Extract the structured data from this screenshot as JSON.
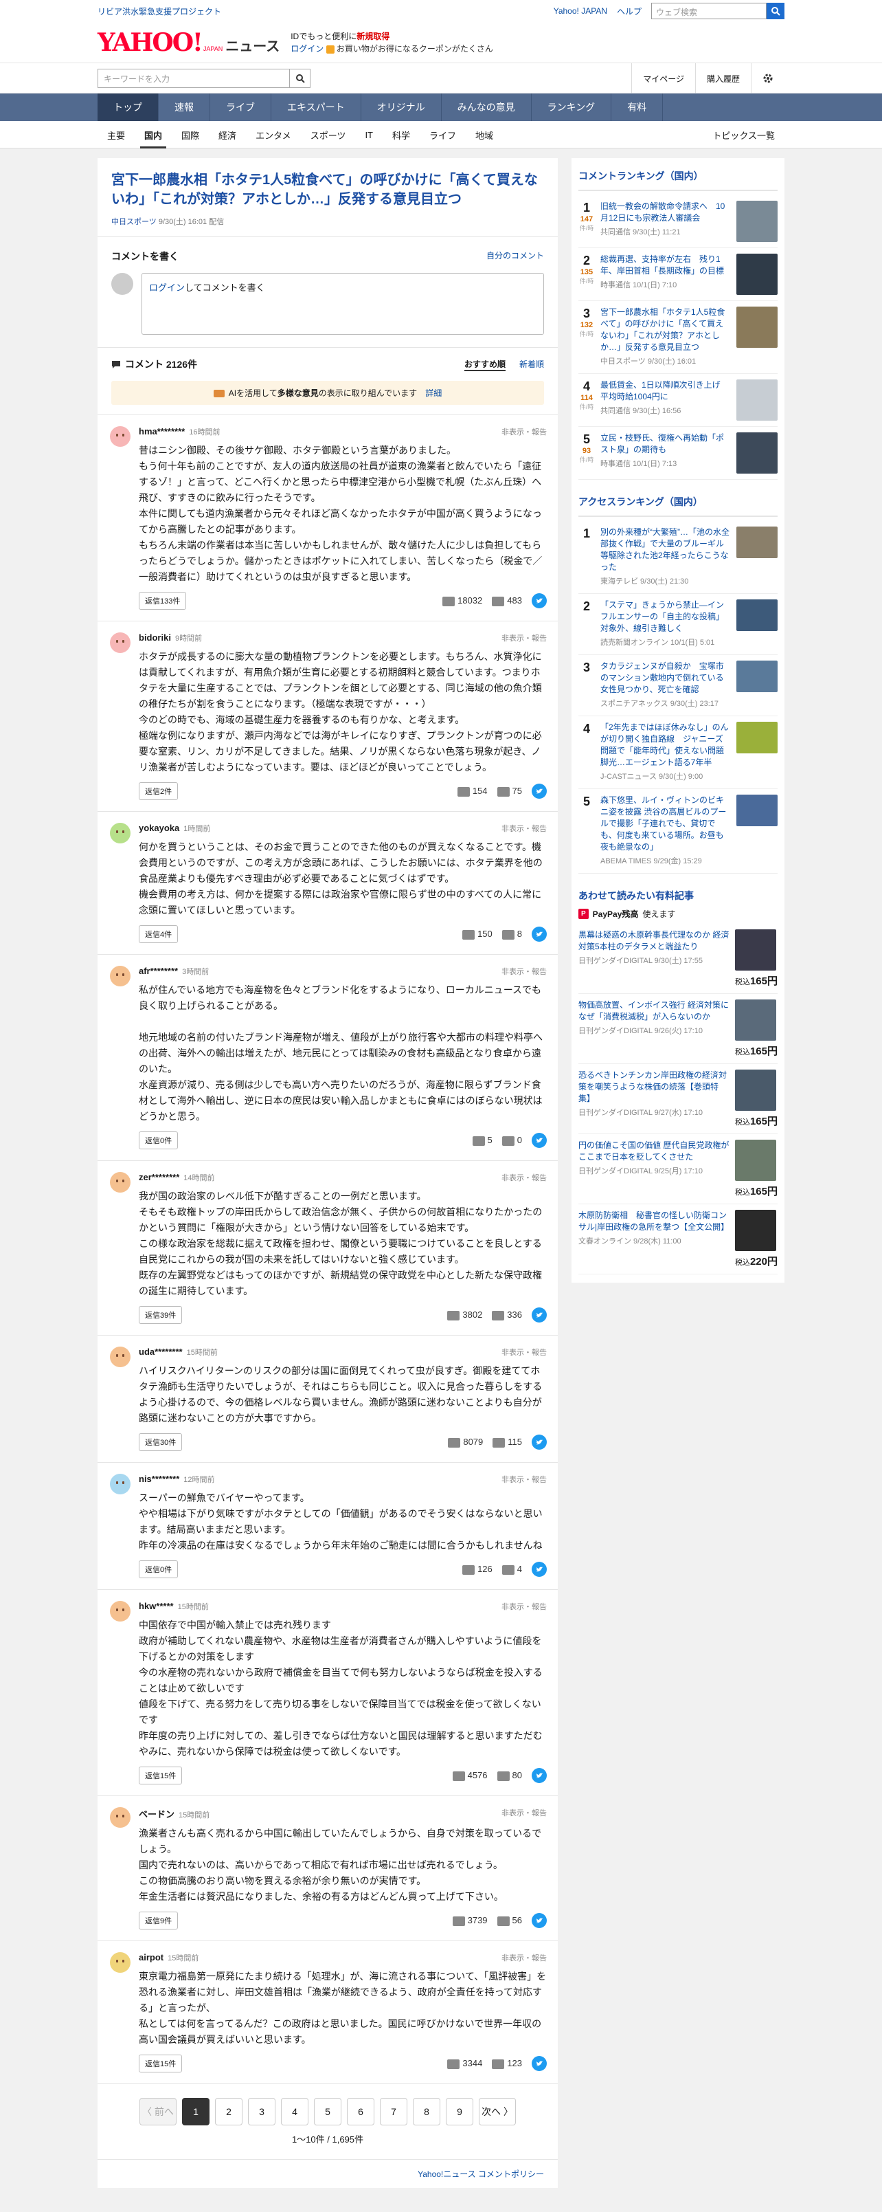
{
  "topbar": {
    "project": "リビア洪水緊急支援プロジェクト",
    "yahoo_japan": "Yahoo! JAPAN",
    "help": "ヘルプ",
    "search_placeholder": "ウェブ検索"
  },
  "brand": {
    "logo": "YAHOO!",
    "logo_sub": "JAPAN",
    "service": "ニュース",
    "promo_text": "IDでもっと便利に",
    "promo_link": "新規取得",
    "login": "ログイン",
    "coupon": "お買い物がお得になるクーポンがたくさん"
  },
  "searchbar": {
    "placeholder": "キーワードを入力",
    "mypage": "マイページ",
    "history": "購入履歴"
  },
  "gnav": [
    "トップ",
    "速報",
    "ライブ",
    "エキスパート",
    "オリジナル",
    "みんなの意見",
    "ランキング",
    "有料"
  ],
  "snav": [
    "主要",
    "国内",
    "国際",
    "経済",
    "エンタメ",
    "スポーツ",
    "IT",
    "科学",
    "ライフ",
    "地域"
  ],
  "snav_right": "トピックス一覧",
  "article": {
    "title": "宮下一郎農水相「ホタテ1人5粒食べて」の呼びかけに「高くて買えないわ」「これが対策？アホとしか…」反発する意見目立つ",
    "source": "中日スポーツ",
    "date": "9/30(土) 16:01",
    "delivered": "配信"
  },
  "write": {
    "title": "コメントを書く",
    "my_comments": "自分のコメント",
    "login": "ログイン",
    "placeholder": "してコメントを書く"
  },
  "comments_head": {
    "count": "コメント 2126件",
    "sort_recommend": "おすすめ順",
    "sort_new": "新着順",
    "ai_prefix": "AIを活用して",
    "ai_bold": "多様な意見",
    "ai_suffix": "の表示に取り組んでいます",
    "ai_detail": "詳細"
  },
  "comment_meta": {
    "hide_report": "非表示・報告"
  },
  "comments": [
    {
      "user": "hma********",
      "ago": "16時間前",
      "face": "#f7b6b6",
      "text": "昔はニシン御殿、その後サケ御殿、ホタテ御殿という言葉がありました。\nもう何十年も前のことですが、友人の道内放送局の社員が道東の漁業者と飲んでいたら「遠征するゾ！」と言って、どこへ行くかと思ったら中標津空港から小型機で札幌（たぶん丘珠）へ飛び、すすきのに飲みに行ったそうです。\n本件に関しても道内漁業者から元々それほど高くなかったホタテが中国が高く買うようになってから高騰したとの記事があります。\nもちろん末端の作業者は本当に苦しいかもしれませんが、散々儲けた人に少しは負担してもらったらどうでしょうか。儲かったときはポケットに入れてしまい、苦しくなったら（税金で／一般消費者に）助けてくれというのは虫が良すぎると思います。",
      "replies": "返信133件",
      "up": "18032",
      "down": "483"
    },
    {
      "user": "bidoriki",
      "ago": "9時間前",
      "face": "#f7b6b6",
      "text": "ホタテが成長するのに膨大な量の動植物プランクトンを必要とします。もちろん、水質浄化には貢献してくれますが、有用魚介類が生育に必要とする初期餌料と競合しています。つまりホタテを大量に生産することでは、プランクトンを餌として必要とする、同じ海域の他の魚介類の稚仔たちが割を食うことになります。（極端な表現ですが・・・）\n今のどの時でも、海域の基礎生産力を器養するのも有りかな、と考えます。\n極端な例になりますが、瀬戸内海などでは海がキレイになりすぎ、プランクトンが育つのに必要な窒素、リン、カリが不足してきました。結果、ノリが黒くならない色落ち現象が起き、ノリ漁業者が苦しむようになっています。要は、ほどほどが良いってことでしょう。",
      "replies": "返信2件",
      "up": "154",
      "down": "75"
    },
    {
      "user": "yokayoka",
      "ago": "1時間前",
      "face": "#b7e08a",
      "text": "何かを買うということは、そのお金で買うことのできた他のものが買えなくなることです。機会費用というのですが、この考え方が念頭にあれば、こうしたお願いには、ホタテ業界を他の食品産業よりも優先すべき理由が必ず必要であることに気づくはずです。\n機会費用の考え方は、何かを提案する際には政治家や官僚に限らず世の中のすべての人に常に念頭に置いてほしいと思っています。",
      "replies": "返信4件",
      "up": "150",
      "down": "8"
    },
    {
      "user": "afr********",
      "ago": "3時間前",
      "face": "#f5c08f",
      "text": "私が住んでいる地方でも海産物を色々とブランド化をするようになり、ローカルニュースでも良く取り上げられることがある。\n\n地元地域の名前の付いたブランド海産物が増え、値段が上がり旅行客や大都市の料理や料亭への出荷、海外への輸出は増えたが、地元民にとっては馴染みの食材も高級品となり食卓から遠のいた。\n水産資源が減り、売る側は少しでも高い方へ売りたいのだろうが、海産物に限らずブランド食材として海外へ輸出し、逆に日本の庶民は安い輸入品しかまともに食卓にはのぼらない現状はどうかと思う。",
      "replies": "返信0件",
      "up": "5",
      "down": "0"
    },
    {
      "user": "zer********",
      "ago": "14時間前",
      "face": "#f5c08f",
      "text": "我が国の政治家のレベル低下が酷すぎることの一例だと思います。\nそもそも政権トップの岸田氏からして政治信念が無く、子供からの何故首相になりたかったのかという質問に「権限が大きから」という情けない回答をしている始末です。\nこの様な政治家を総裁に据えて政権を担わせ、閣僚という要職につけていることを良しとする自民党にこれからの我が国の未来を託してはいけないと強く感じています。\n既存の左翼野党などはもってのほかですが、新規結党の保守政党を中心とした新たな保守政権の誕生に期待しています。",
      "replies": "返信39件",
      "up": "3802",
      "down": "336"
    },
    {
      "user": "uda********",
      "ago": "15時間前",
      "face": "#f5c08f",
      "text": "ハイリスクハイリターンのリスクの部分は国に面倒見てくれって虫が良すぎ。御殿を建ててホタテ漁師も生活守りたいでしょうが、それはこちらも同じこと。収入に見合った暮らしをするよう心掛けるので、今の価格レベルなら買いません。漁師が路頭に迷わないことよりも自分が路頭に迷わないことの方が大事ですから。",
      "replies": "返信30件",
      "up": "8079",
      "down": "115"
    },
    {
      "user": "nis********",
      "ago": "12時間前",
      "face": "#a8d8f0",
      "text": "スーパーの鮮魚でバイヤーやってます。\nやや相場は下がり気味ですがホタテとしての「価値観」があるのでそう安くはならないと思います。結局高いままだと思います。\n昨年の冷凍品の在庫は安くなるでしょうから年末年始のご馳走には間に合うかもしれませんね",
      "replies": "返信0件",
      "up": "126",
      "down": "4"
    },
    {
      "user": "hkw*****",
      "ago": "15時間前",
      "face": "#f5c08f",
      "text": "中国依存で中国が輸入禁止では売れ残ります\n政府が補助してくれない農産物や、水産物は生産者が消費者さんが購入しやすいように値段を下げるとかの対策をします\n今の水産物の売れないから政府で補償金を目当てで何も努力しないようならば税金を投入することは止めて欲しいです\n値段を下げて、売る努力をして売り切る事をしないで保障目当てでは税金を使って欲しくないです\n昨年度の売り上げに対しての、差し引きでならば仕方ないと国民は理解すると思いますただむやみに、売れないから保障では税金は使って欲しくないです。",
      "replies": "返信15件",
      "up": "4576",
      "down": "80"
    },
    {
      "user": "ベードン",
      "ago": "15時間前",
      "face": "#f5c08f",
      "text": "漁業者さんも高く売れるから中国に輸出していたんでしょうから、自身で対策を取っているでしょう。\n国内で売れないのは、高いからであって相応で有れば市場に出せば売れるでしょう。\nこの物価高騰のおり高い物を買える余裕が余り無いのが実情です。\n年金生活者には贅沢品になりました、余裕の有る方はどんどん買って上げて下さい。",
      "replies": "返信9件",
      "up": "3739",
      "down": "56"
    },
    {
      "user": "airpot",
      "ago": "15時間前",
      "face": "#f0d47a",
      "text": "東京電力福島第一原発にたまり続ける「処理水」が、海に流される事について、「風評被害」を恐れる漁業者に対し、岸田文雄首相は「漁業が継続できるよう、政府が全責任を持って対応する」と言ったが、\n私としては何を言ってるんだ？この政府はと思いました。国民に呼びかけないで世界一年収の高い国会議員が買えばいいと思います。",
      "replies": "返信15件",
      "up": "3344",
      "down": "123"
    }
  ],
  "pager": {
    "prev": "〈 前へ",
    "next": "次へ 〉",
    "pages": [
      "1",
      "2",
      "3",
      "4",
      "5",
      "6",
      "7",
      "8",
      "9"
    ],
    "current": "1",
    "info": "1〜10件 / 1,695件"
  },
  "policy": "Yahoo!ニュース コメントポリシー",
  "sidebar": {
    "comment_ranking_title": "コメントランキング（国内）",
    "comment_ranking": [
      {
        "rank": "1",
        "count": "147",
        "unit": "件/時",
        "title": "旧統一教会の解散命令請求へ　10月12日にも宗教法人審議会",
        "source": "共同通信 9/30(土) 11:21",
        "color": "#7a8a96"
      },
      {
        "rank": "2",
        "count": "135",
        "unit": "件/時",
        "title": "総裁再選、支持率が左右　残り1年、岸田首相「長期政権」の目標",
        "source": "時事通信 10/1(日) 7:10",
        "color": "#2f3b48"
      },
      {
        "rank": "3",
        "count": "132",
        "unit": "件/時",
        "title": "宮下一郎農水相「ホタテ1人5粒食べて」の呼びかけに「高くて買えないわ」「これが対策？アホとしか…」反発する意見目立つ",
        "source": "中日スポーツ 9/30(土) 16:01",
        "color": "#8a7a5a"
      },
      {
        "rank": "4",
        "count": "114",
        "unit": "件/時",
        "title": "最低賃金、1日以降順次引き上げ　平均時給1004円に",
        "source": "共同通信 9/30(土) 16:56",
        "color": "#c7cdd3"
      },
      {
        "rank": "5",
        "count": "93",
        "unit": "件/時",
        "title": "立民・枝野氏、復権へ再始動「ポスト泉」の期待も",
        "source": "時事通信 10/1(日) 7:13",
        "color": "#3d4a5a"
      }
    ],
    "access_ranking_title": "アクセスランキング（国内）",
    "access_ranking": [
      {
        "rank": "1",
        "title": "別の外来種が“大繁殖”…「池の水全部抜く作戦」で大量のブルーギル等駆除された池2年経ったらこうなった",
        "source": "東海テレビ 9/30(土) 21:30",
        "color": "#8a7f6a"
      },
      {
        "rank": "2",
        "title": "「ステマ」きょうから禁止―インフルエンサーの「自主的な投稿」対象外、線引き難しく",
        "source": "読売新聞オンライン 10/1(日) 5:01",
        "color": "#3d5a7a"
      },
      {
        "rank": "3",
        "title": "タカラジェンヌが自殺か　宝塚市のマンション敷地内で倒れている女性見つかり、死亡を確認",
        "source": "スポニチアネックス 9/30(土) 23:17",
        "color": "#5a7a9a"
      },
      {
        "rank": "4",
        "title": "「2年先まではほぼ休みなし」のんが切り開く独自路線　ジャニーズ問題で「能年時代」使えない問題脚光…エージェント語る7年半",
        "source": "J-CASTニュース 9/30(土) 9:00",
        "color": "#9ab03a"
      },
      {
        "rank": "5",
        "title": "森下悠里、ルイ・ヴィトンのビキニ姿を披露 渋谷の高層ビルのプールで撮影「子連れでも、貸切でも、何度も来ている場所。お昼も夜も絶景なの」",
        "source": "ABEMA TIMES 9/29(金) 15:29",
        "color": "#4a6a9a"
      }
    ],
    "paid_title": "あわせて読みたい有料記事",
    "paypay": "PayPay残高",
    "paypay_suffix": "使えます",
    "paid": [
      {
        "title": "黒幕は疑惑の木原幹事長代理なのか 経済対策5本柱のデタラメと端益たり",
        "source": "日刊ゲンダイDIGITAL 9/30(土) 17:55",
        "price_prefix": "税込",
        "price": "165円",
        "color": "#3a3a4a"
      },
      {
        "title": "物価高放置、インボイス強行 経済対策になぜ「消費税減税」が入らないのか",
        "source": "日刊ゲンダイDIGITAL 9/26(火) 17:10",
        "price_prefix": "税込",
        "price": "165円",
        "color": "#5a6a7a"
      },
      {
        "title": "恐るべきトンチンカン岸田政権の経済対策を嘲笑うような株価の続落【巻頭特集】",
        "source": "日刊ゲンダイDIGITAL 9/27(水) 17:10",
        "price_prefix": "税込",
        "price": "165円",
        "color": "#4a5a6a"
      },
      {
        "title": "円の価値こそ国の価値 歴代自民党政権がここまで日本を貶してくさせた",
        "source": "日刊ゲンダイDIGITAL 9/25(月) 17:10",
        "price_prefix": "税込",
        "price": "165円",
        "color": "#6a7a6a"
      },
      {
        "title": "木原防防衛相　秘書官の怪しい防衛コンサル|岸田政権の急所を撃つ【全文公開】",
        "source": "文春オンライン 9/28(木) 11:00",
        "price_prefix": "税込",
        "price": "220円",
        "color": "#2a2a2a"
      }
    ]
  }
}
